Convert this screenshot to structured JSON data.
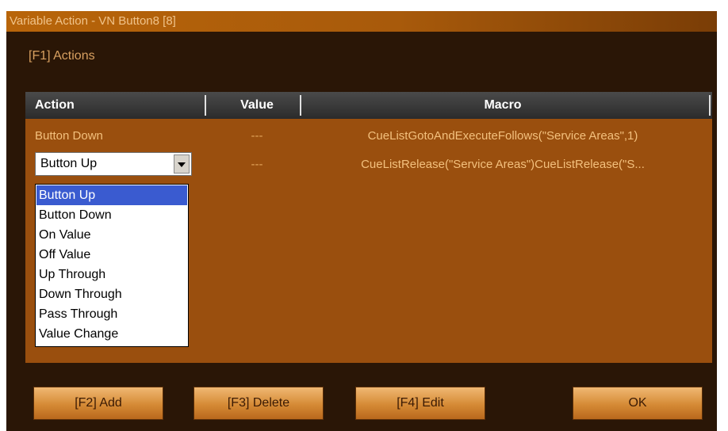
{
  "window": {
    "title": "Variable Action - VN Button8 [8]"
  },
  "section": {
    "label": "[F1] Actions"
  },
  "table": {
    "headers": {
      "action": "Action",
      "value": "Value",
      "macro": "Macro"
    },
    "rows": [
      {
        "action": "Button Down",
        "value": "---",
        "macro": "CueListGotoAndExecuteFollows(\"Service Areas\",1)"
      },
      {
        "action": "Button Up",
        "value": "---",
        "macro": "CueListRelease(\"Service Areas\")CueListRelease(\"S..."
      }
    ]
  },
  "dropdown": {
    "selected": "Button Up",
    "options": [
      "Button Up",
      "Button Down",
      "On Value",
      "Off Value",
      "Up Through",
      "Down Through",
      "Pass Through",
      "Value Change"
    ]
  },
  "buttons": {
    "add": "[F2] Add",
    "delete": "[F3] Delete",
    "edit": "[F4] Edit",
    "ok": "OK"
  },
  "colors": {
    "accent": "#9a4f0e",
    "titlebar": "#b8650a",
    "selection": "#3a5bd0"
  }
}
